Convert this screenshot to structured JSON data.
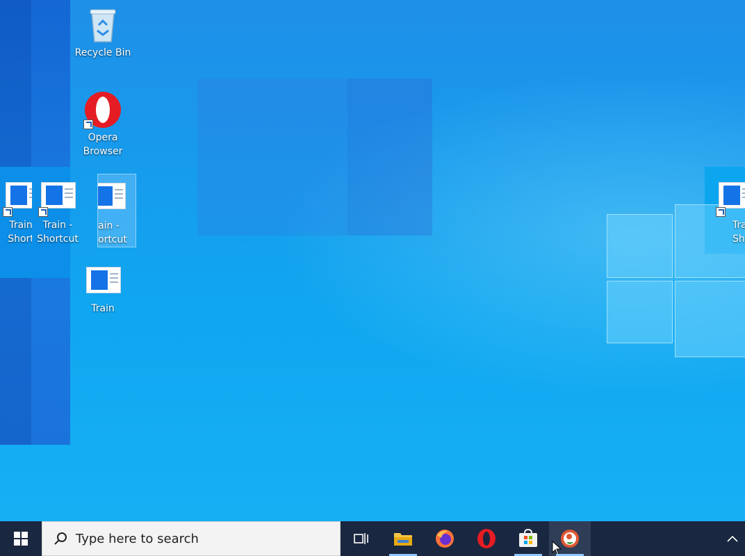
{
  "desktop": {
    "icons": [
      {
        "label": "Recycle Bin",
        "icon": "recycle-bin-icon"
      },
      {
        "label": "Opera\nBrowser",
        "icon": "opera-icon"
      },
      {
        "label": "Train\nShort",
        "icon": "document-shortcut-icon"
      },
      {
        "label": "Train -\nShortcut",
        "icon": "document-shortcut-icon"
      },
      {
        "label": "ain -\nortcut",
        "icon": "document-shortcut-icon"
      },
      {
        "label": "Train",
        "icon": "document-icon"
      },
      {
        "label": "Train\nShort",
        "icon": "document-shortcut-icon"
      }
    ]
  },
  "taskbar": {
    "search_placeholder": "Type here to search",
    "items": [
      {
        "name": "start",
        "icon": "windows-start-icon"
      },
      {
        "name": "task-view",
        "icon": "task-view-icon"
      },
      {
        "name": "file-explorer",
        "icon": "folder-icon",
        "running": true
      },
      {
        "name": "firefox",
        "icon": "firefox-icon",
        "running": false
      },
      {
        "name": "opera",
        "icon": "opera-icon",
        "running": false
      },
      {
        "name": "microsoft-store",
        "icon": "store-icon",
        "running": true
      },
      {
        "name": "app",
        "icon": "app-icon",
        "running": true,
        "active": true
      }
    ],
    "tray_icon": "chevron-up-icon"
  },
  "colors": {
    "taskbar_bg": "#1a2740",
    "desktop_blue": "#10a6f0",
    "opera_red": "#e51c23"
  }
}
